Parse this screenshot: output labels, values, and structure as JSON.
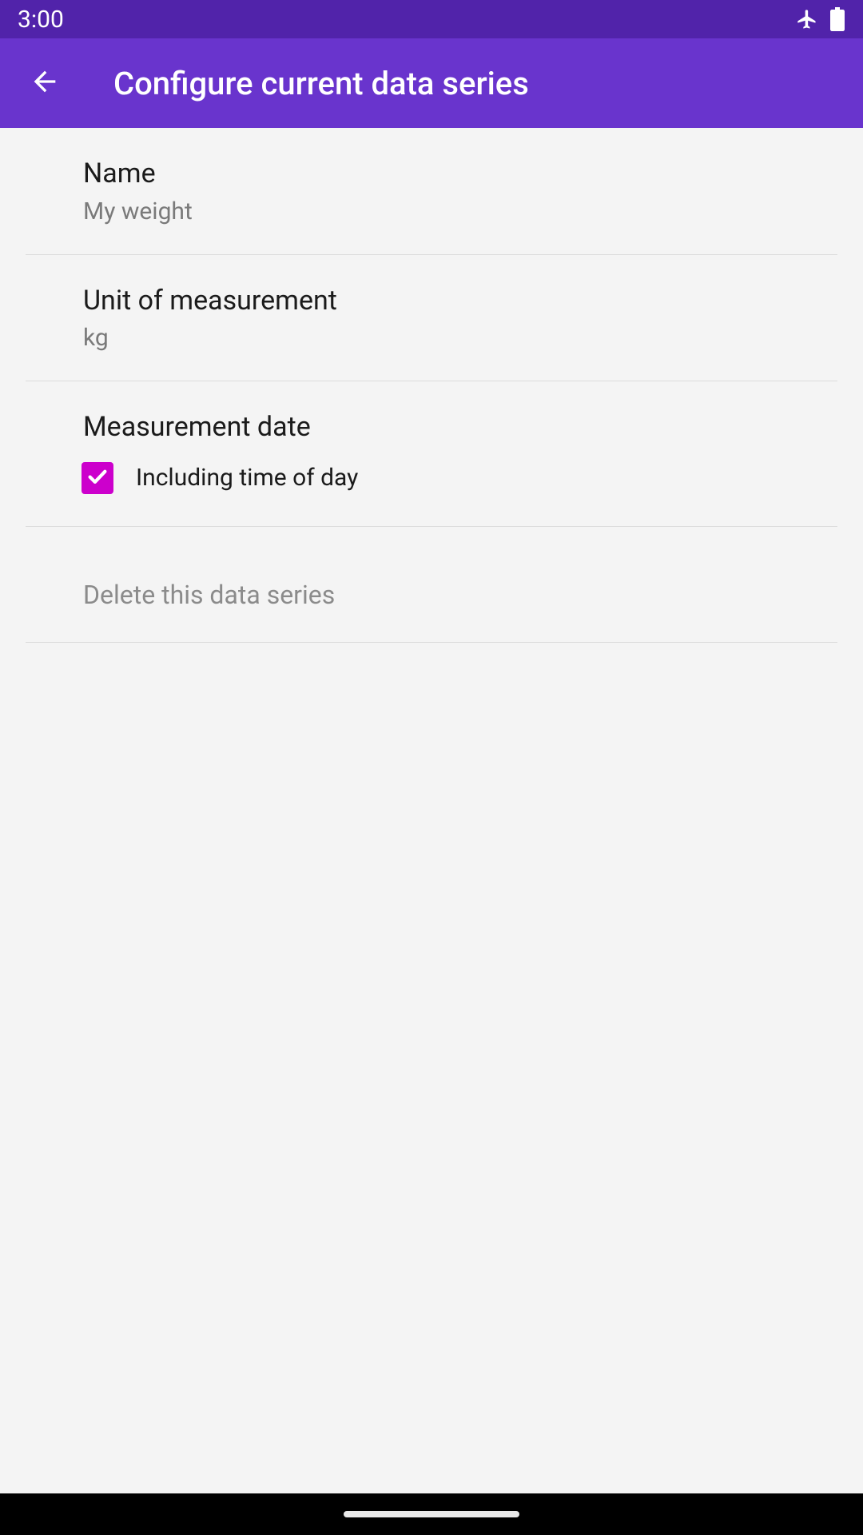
{
  "status": {
    "time": "3:00"
  },
  "appbar": {
    "title": "Configure current data series"
  },
  "rows": {
    "name": {
      "label": "Name",
      "value": "My weight"
    },
    "unit": {
      "label": "Unit of measurement",
      "value": "kg"
    },
    "date": {
      "label": "Measurement date",
      "checkbox_label": "Including time of day",
      "checked": true
    },
    "delete": {
      "label": "Delete this data series"
    }
  },
  "colors": {
    "status_bar": "#5123aa",
    "app_bar": "#6934cd",
    "checkbox_accent": "#cc00cc"
  }
}
